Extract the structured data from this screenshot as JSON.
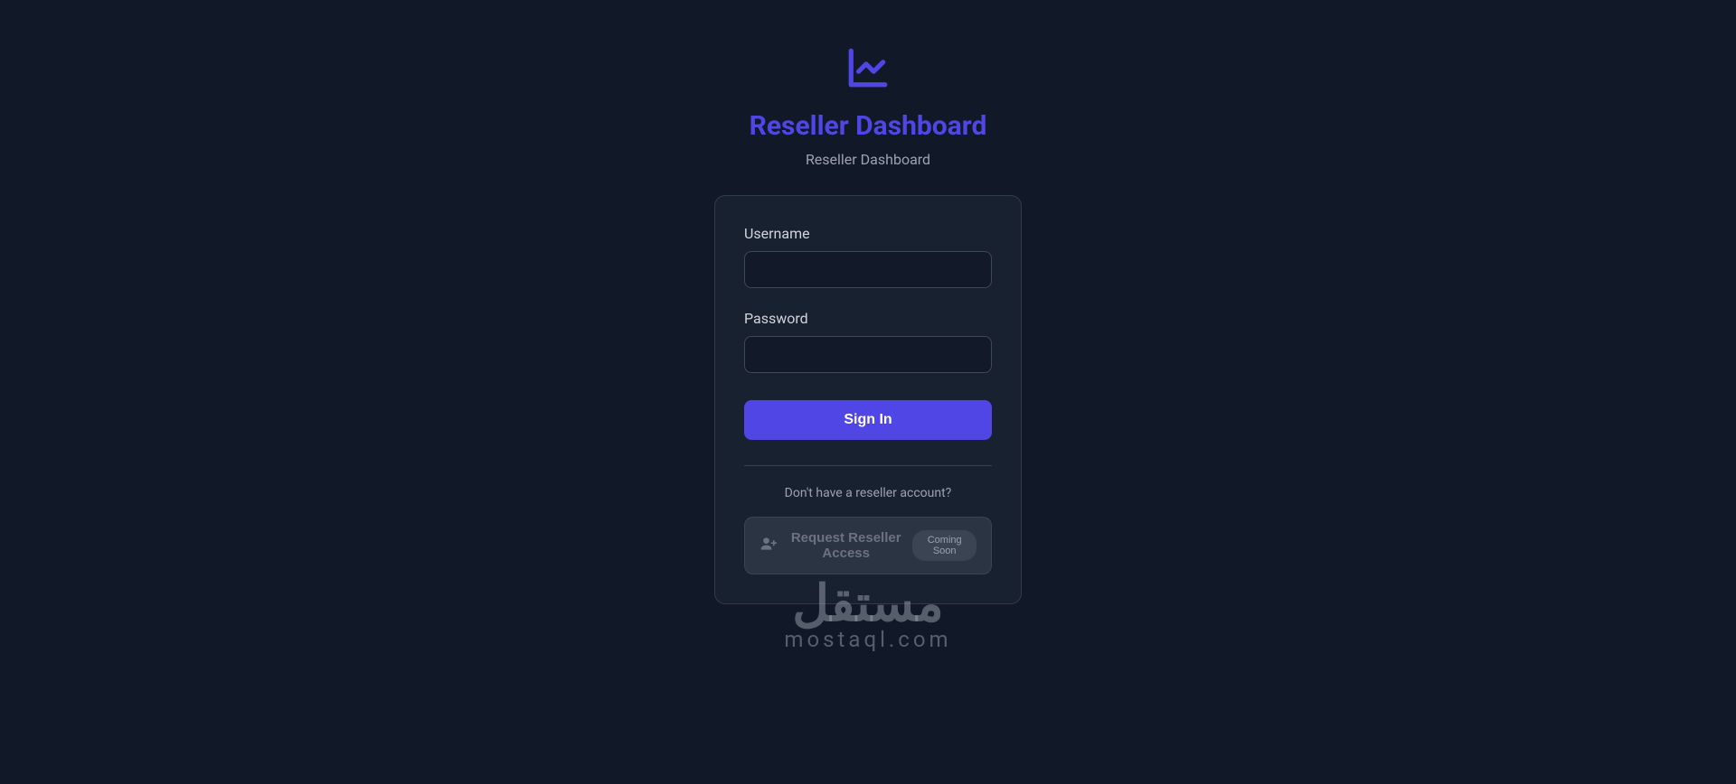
{
  "header": {
    "title": "Reseller Dashboard",
    "subtitle": "Reseller Dashboard"
  },
  "form": {
    "username_label": "Username",
    "password_label": "Password",
    "signin_button": "Sign In"
  },
  "footer": {
    "prompt": "Don't have a reseller account?",
    "request_access_label": "Request Reseller Access",
    "coming_soon": "Coming Soon"
  },
  "watermark": {
    "arabic": "مستقل",
    "latin": "mostaql.com"
  }
}
